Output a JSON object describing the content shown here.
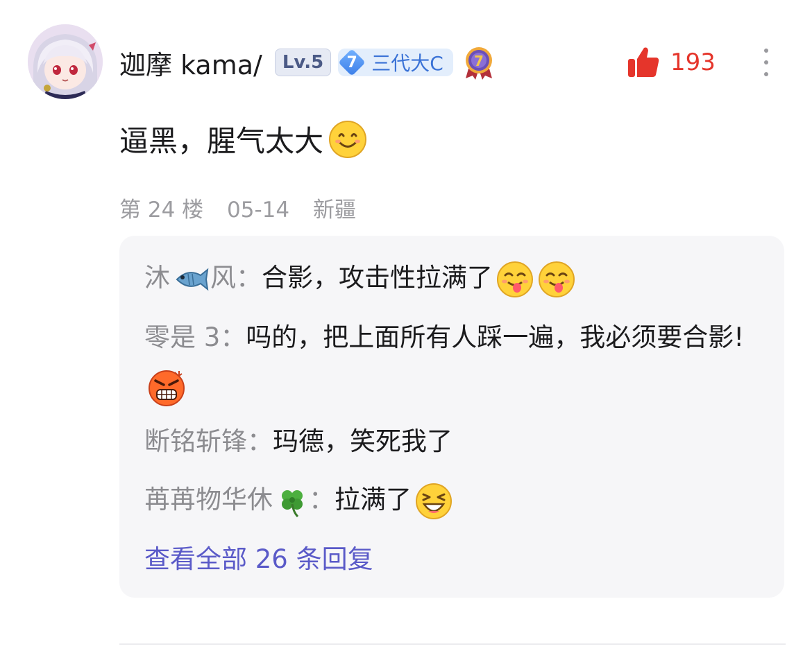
{
  "user": {
    "name": "迦摩 kama/",
    "level": "Lv.5",
    "rank_number": "7",
    "rank_label": "三代大C",
    "medal_number": "7"
  },
  "like": {
    "count": "193"
  },
  "comment": {
    "text": "逼黑，腥气太大"
  },
  "meta": {
    "floor": "第 24 楼",
    "date": "05-14",
    "location": "新疆"
  },
  "replies": [
    {
      "author_a": "沐",
      "author_b": "风",
      "sep": "：",
      "text": "合影，攻击性拉满了"
    },
    {
      "author": "零是 3",
      "sep": "：",
      "text": "吗的，把上面所有人踩一遍，我必须要合影!"
    },
    {
      "author": "断铭斩锋",
      "sep": "：",
      "text": "玛德，笑死我了"
    },
    {
      "author": "苒苒物华休",
      "sep": "：",
      "text": "拉满了"
    }
  ],
  "view_all": "查看全部 26 条回复",
  "colors": {
    "accent_red": "#e5352b",
    "link_purple": "#5a5ac8",
    "muted_gray": "#9c9ca0"
  },
  "icons": [
    "avatar-illustration",
    "rank-diamond-icon",
    "medal-icon",
    "thumbs-up-icon",
    "more-vertical-icon",
    "smile-emoji",
    "fish-emoji",
    "tongue-emoji",
    "angry-emoji",
    "clover-emoji",
    "laugh-emoji"
  ]
}
